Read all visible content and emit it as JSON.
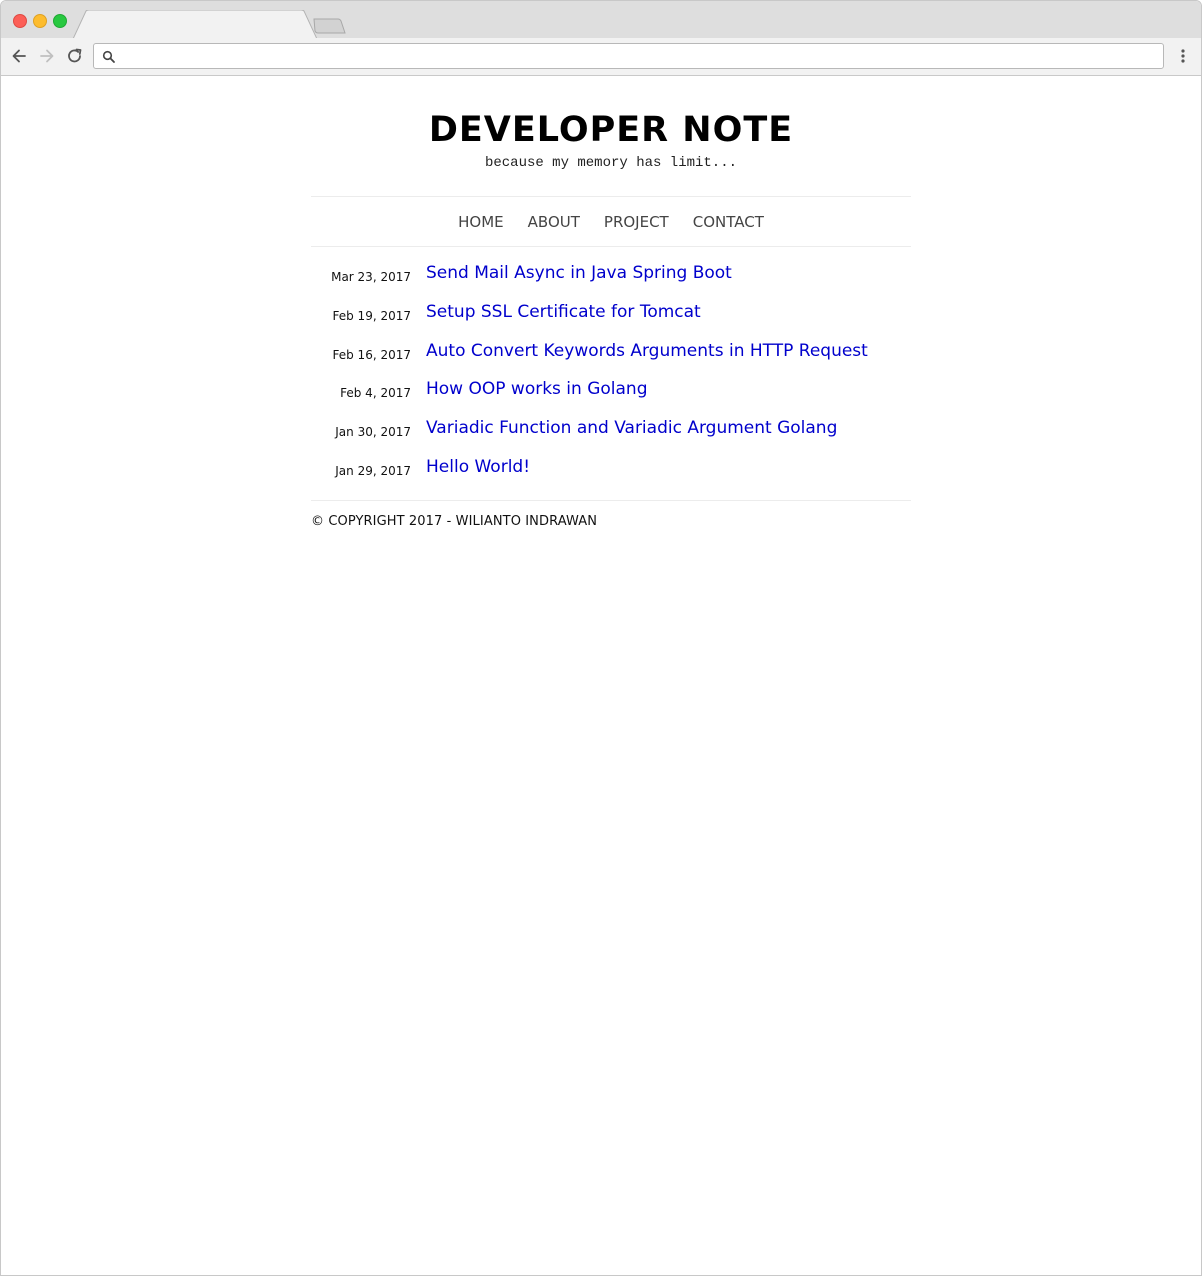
{
  "browser": {
    "tab_title": "",
    "url": ""
  },
  "site": {
    "title": "DEVELOPER NOTE",
    "tagline": "because my memory has limit..."
  },
  "nav": [
    "HOME",
    "ABOUT",
    "PROJECT",
    "CONTACT"
  ],
  "posts": [
    {
      "date": "Mar 23, 2017",
      "title": "Send Mail Async in Java Spring Boot"
    },
    {
      "date": "Feb 19, 2017",
      "title": "Setup SSL Certificate for Tomcat"
    },
    {
      "date": "Feb 16, 2017",
      "title": "Auto Convert Keywords Arguments in HTTP Request"
    },
    {
      "date": "Feb 4, 2017",
      "title": "How OOP works in Golang"
    },
    {
      "date": "Jan 30, 2017",
      "title": "Variadic Function and Variadic Argument Golang"
    },
    {
      "date": "Jan 29, 2017",
      "title": "Hello World!"
    }
  ],
  "footer": "© COPYRIGHT 2017 - WILIANTO INDRAWAN",
  "icons": {
    "back": "arrow-left-icon",
    "forward": "arrow-right-icon",
    "reload": "reload-icon",
    "search": "search-icon",
    "menu": "kebab-menu-icon"
  },
  "colors": {
    "link": "#0000cc",
    "nav_text": "#444444",
    "titlebar": "#dedede",
    "close": "#fc5f57",
    "minimize": "#fdbc2e",
    "maximize": "#28c840"
  }
}
